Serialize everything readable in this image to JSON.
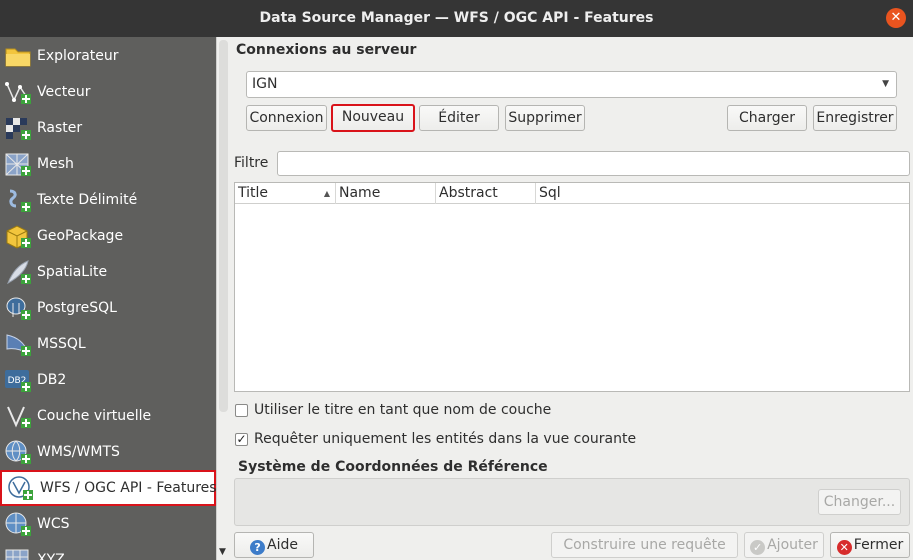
{
  "window": {
    "title": "Data Source Manager — WFS / OGC API - Features"
  },
  "sidebar": {
    "items": [
      {
        "label": "Explorateur",
        "icon": "folder-icon"
      },
      {
        "label": "Vecteur",
        "icon": "vector-icon"
      },
      {
        "label": "Raster",
        "icon": "raster-icon"
      },
      {
        "label": "Mesh",
        "icon": "mesh-icon"
      },
      {
        "label": "Texte Délimité",
        "icon": "delimited-text-icon"
      },
      {
        "label": "GeoPackage",
        "icon": "geopackage-icon"
      },
      {
        "label": "SpatiaLite",
        "icon": "spatialite-icon"
      },
      {
        "label": "PostgreSQL",
        "icon": "postgresql-icon"
      },
      {
        "label": "MSSQL",
        "icon": "mssql-icon"
      },
      {
        "label": "DB2",
        "icon": "db2-icon"
      },
      {
        "label": "Couche virtuelle",
        "icon": "virtual-layer-icon"
      },
      {
        "label": "WMS/WMTS",
        "icon": "wms-icon"
      },
      {
        "label": "WFS / OGC API - Features",
        "icon": "wfs-icon",
        "active": true
      },
      {
        "label": "WCS",
        "icon": "wcs-icon"
      },
      {
        "label": "XYZ",
        "icon": "xyz-icon"
      }
    ]
  },
  "connections": {
    "title": "Connexions au serveur",
    "selected": "IGN",
    "buttons": {
      "connect": "Connexion",
      "new": "Nouveau",
      "edit": "Éditer",
      "delete": "Supprimer",
      "load": "Charger",
      "save": "Enregistrer"
    }
  },
  "filter": {
    "label": "Filtre",
    "value": ""
  },
  "table": {
    "columns": [
      "Title",
      "Name",
      "Abstract",
      "Sql"
    ]
  },
  "options": {
    "use_title": {
      "label": "Utiliser le titre en tant que nom de couche",
      "checked": false
    },
    "only_view": {
      "label": "Requêter uniquement les entités dans la vue courante",
      "checked": true
    }
  },
  "crs": {
    "title": "Système de Coordonnées de Référence",
    "change": "Changer..."
  },
  "footer": {
    "help": "Aide",
    "build_query": "Construire une requête",
    "add": "Ajouter",
    "close": "Fermer"
  },
  "colors": {
    "sidebar_bg": "#5f5f5d",
    "highlight": "#d9131a",
    "titlebar": "#353535",
    "close": "#e9541f"
  }
}
